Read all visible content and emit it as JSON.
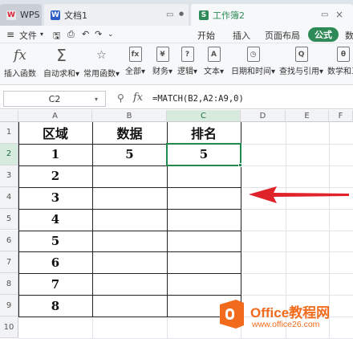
{
  "tabs": [
    {
      "label": "WPS",
      "icon": "wps-logo-icon"
    },
    {
      "label": "文档1",
      "icon": "writer-doc-icon"
    },
    {
      "label": "工作簿2",
      "icon": "spreadsheet-icon"
    }
  ],
  "menu": {
    "file": "文件",
    "items": [
      "开始",
      "插入",
      "页面布局",
      "公式",
      "数"
    ],
    "active": "公式"
  },
  "ribbon": [
    {
      "label": "插入函数",
      "icon": "fx-icon"
    },
    {
      "label": "自动求和",
      "icon": "sigma-icon",
      "dropdown": true
    },
    {
      "label": "常用函数",
      "icon": "star-function-icon",
      "dropdown": true
    },
    {
      "label": "全部",
      "icon": "all-functions-icon",
      "dropdown": true
    },
    {
      "label": "财务",
      "icon": "finance-book-icon",
      "dropdown": true
    },
    {
      "label": "逻辑",
      "icon": "logic-book-icon",
      "dropdown": true
    },
    {
      "label": "文本",
      "icon": "text-book-icon",
      "dropdown": true
    },
    {
      "label": "日期和时间",
      "icon": "date-book-icon",
      "dropdown": true
    },
    {
      "label": "查找与引用",
      "icon": "lookup-book-icon",
      "dropdown": true
    },
    {
      "label": "数学和三",
      "icon": "math-book-icon"
    }
  ],
  "formula_bar": {
    "name_box": "C2",
    "fx_label": "fx",
    "formula": "=MATCH(B2,A2:A9,0)"
  },
  "columns": [
    "A",
    "B",
    "C",
    "D",
    "E",
    "F"
  ],
  "rows": [
    "1",
    "2",
    "3",
    "4",
    "5",
    "6",
    "7",
    "8",
    "9",
    "10"
  ],
  "cells": {
    "A1": "区域",
    "B1": "数据",
    "C1": "排名",
    "A2": "1",
    "B2": "5",
    "C2": "5",
    "A3": "2",
    "A4": "3",
    "A5": "4",
    "A6": "5",
    "A7": "6",
    "A8": "7",
    "A9": "8"
  },
  "selected_cell": "C2",
  "watermark": {
    "brand": "Office教程网",
    "url": "www.office26.com"
  },
  "colors": {
    "accent": "#2e8b57",
    "arrow": "#e0222a",
    "watermark_orange": "#f26b1d"
  }
}
